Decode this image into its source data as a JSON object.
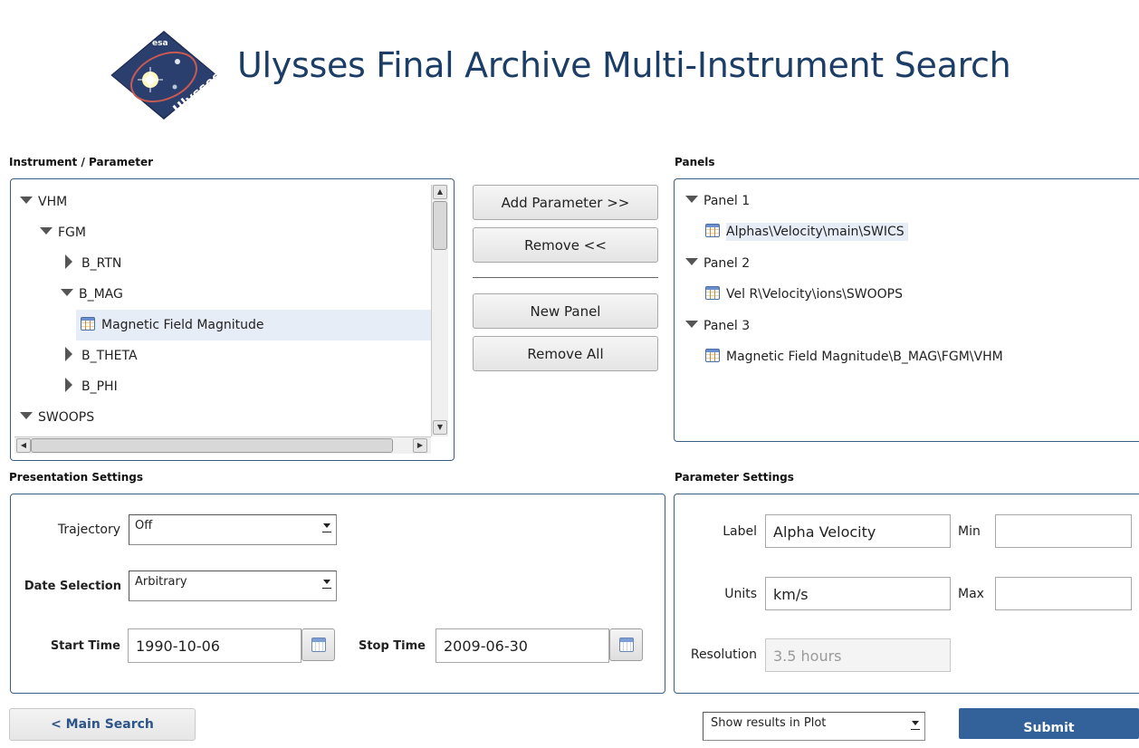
{
  "header": {
    "title": "Ulysses Final Archive Multi-Instrument Search",
    "logo_text": {
      "top": "esa",
      "bottom": "Ulysses"
    }
  },
  "instrument": {
    "label": "Instrument / Parameter",
    "tree": [
      {
        "label": "VHM",
        "state": "expanded"
      },
      {
        "label": "FGM",
        "state": "expanded"
      },
      {
        "label": "B_RTN",
        "state": "collapsed"
      },
      {
        "label": "B_MAG",
        "state": "expanded"
      },
      {
        "label": "Magnetic Field Magnitude",
        "state": "leaf",
        "selected": true
      },
      {
        "label": "B_THETA",
        "state": "collapsed"
      },
      {
        "label": "B_PHI",
        "state": "collapsed"
      },
      {
        "label": "SWOOPS",
        "state": "expanded"
      }
    ]
  },
  "actions": {
    "add": "Add Parameter >>",
    "remove": "Remove <<",
    "new_panel": "New Panel",
    "remove_all": "Remove All"
  },
  "panels": {
    "label": "Panels",
    "items": [
      {
        "label": "Panel 1",
        "param": "Alphas\\Velocity\\main\\SWICS"
      },
      {
        "label": "Panel 2",
        "param": "Vel R\\Velocity\\ions\\SWOOPS"
      },
      {
        "label": "Panel 3",
        "param": "Magnetic Field Magnitude\\B_MAG\\FGM\\VHM"
      }
    ]
  },
  "presentation": {
    "label": "Presentation Settings",
    "trajectory_label": "Trajectory",
    "trajectory_value": "Off",
    "date_selection_label": "Date Selection",
    "date_selection_value": "Arbitrary",
    "start_label": "Start Time",
    "start_value": "1990-10-06",
    "stop_label": "Stop Time",
    "stop_value": "2009-06-30"
  },
  "parameter": {
    "label": "Parameter Settings",
    "label_label": "Label",
    "label_value": "Alpha Velocity",
    "min_label": "Min",
    "min_value": "",
    "units_label": "Units",
    "units_value": "km/s",
    "max_label": "Max",
    "max_value": "",
    "resolution_label": "Resolution",
    "resolution_value": "3.5 hours"
  },
  "footer": {
    "main_search": "< Main Search",
    "output_select": "Show results in Plot",
    "submit": "Submit"
  },
  "colors": {
    "title": "#1c3e66",
    "border": "#3b5e86",
    "submit": "#33629b"
  }
}
